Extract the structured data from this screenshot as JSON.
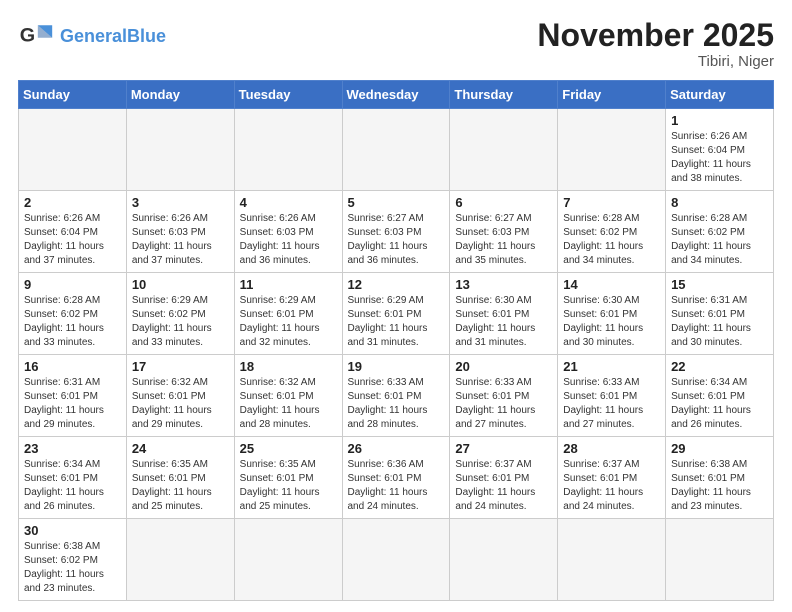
{
  "header": {
    "logo_general": "General",
    "logo_blue": "Blue",
    "month_title": "November 2025",
    "subtitle": "Tibiri, Niger"
  },
  "weekdays": [
    "Sunday",
    "Monday",
    "Tuesday",
    "Wednesday",
    "Thursday",
    "Friday",
    "Saturday"
  ],
  "days": [
    {
      "num": "",
      "info": ""
    },
    {
      "num": "",
      "info": ""
    },
    {
      "num": "",
      "info": ""
    },
    {
      "num": "",
      "info": ""
    },
    {
      "num": "",
      "info": ""
    },
    {
      "num": "",
      "info": ""
    },
    {
      "num": "1",
      "info": "Sunrise: 6:26 AM\nSunset: 6:04 PM\nDaylight: 11 hours\nand 38 minutes."
    },
    {
      "num": "2",
      "info": "Sunrise: 6:26 AM\nSunset: 6:04 PM\nDaylight: 11 hours\nand 37 minutes."
    },
    {
      "num": "3",
      "info": "Sunrise: 6:26 AM\nSunset: 6:03 PM\nDaylight: 11 hours\nand 37 minutes."
    },
    {
      "num": "4",
      "info": "Sunrise: 6:26 AM\nSunset: 6:03 PM\nDaylight: 11 hours\nand 36 minutes."
    },
    {
      "num": "5",
      "info": "Sunrise: 6:27 AM\nSunset: 6:03 PM\nDaylight: 11 hours\nand 36 minutes."
    },
    {
      "num": "6",
      "info": "Sunrise: 6:27 AM\nSunset: 6:03 PM\nDaylight: 11 hours\nand 35 minutes."
    },
    {
      "num": "7",
      "info": "Sunrise: 6:28 AM\nSunset: 6:02 PM\nDaylight: 11 hours\nand 34 minutes."
    },
    {
      "num": "8",
      "info": "Sunrise: 6:28 AM\nSunset: 6:02 PM\nDaylight: 11 hours\nand 34 minutes."
    },
    {
      "num": "9",
      "info": "Sunrise: 6:28 AM\nSunset: 6:02 PM\nDaylight: 11 hours\nand 33 minutes."
    },
    {
      "num": "10",
      "info": "Sunrise: 6:29 AM\nSunset: 6:02 PM\nDaylight: 11 hours\nand 33 minutes."
    },
    {
      "num": "11",
      "info": "Sunrise: 6:29 AM\nSunset: 6:01 PM\nDaylight: 11 hours\nand 32 minutes."
    },
    {
      "num": "12",
      "info": "Sunrise: 6:29 AM\nSunset: 6:01 PM\nDaylight: 11 hours\nand 31 minutes."
    },
    {
      "num": "13",
      "info": "Sunrise: 6:30 AM\nSunset: 6:01 PM\nDaylight: 11 hours\nand 31 minutes."
    },
    {
      "num": "14",
      "info": "Sunrise: 6:30 AM\nSunset: 6:01 PM\nDaylight: 11 hours\nand 30 minutes."
    },
    {
      "num": "15",
      "info": "Sunrise: 6:31 AM\nSunset: 6:01 PM\nDaylight: 11 hours\nand 30 minutes."
    },
    {
      "num": "16",
      "info": "Sunrise: 6:31 AM\nSunset: 6:01 PM\nDaylight: 11 hours\nand 29 minutes."
    },
    {
      "num": "17",
      "info": "Sunrise: 6:32 AM\nSunset: 6:01 PM\nDaylight: 11 hours\nand 29 minutes."
    },
    {
      "num": "18",
      "info": "Sunrise: 6:32 AM\nSunset: 6:01 PM\nDaylight: 11 hours\nand 28 minutes."
    },
    {
      "num": "19",
      "info": "Sunrise: 6:33 AM\nSunset: 6:01 PM\nDaylight: 11 hours\nand 28 minutes."
    },
    {
      "num": "20",
      "info": "Sunrise: 6:33 AM\nSunset: 6:01 PM\nDaylight: 11 hours\nand 27 minutes."
    },
    {
      "num": "21",
      "info": "Sunrise: 6:33 AM\nSunset: 6:01 PM\nDaylight: 11 hours\nand 27 minutes."
    },
    {
      "num": "22",
      "info": "Sunrise: 6:34 AM\nSunset: 6:01 PM\nDaylight: 11 hours\nand 26 minutes."
    },
    {
      "num": "23",
      "info": "Sunrise: 6:34 AM\nSunset: 6:01 PM\nDaylight: 11 hours\nand 26 minutes."
    },
    {
      "num": "24",
      "info": "Sunrise: 6:35 AM\nSunset: 6:01 PM\nDaylight: 11 hours\nand 25 minutes."
    },
    {
      "num": "25",
      "info": "Sunrise: 6:35 AM\nSunset: 6:01 PM\nDaylight: 11 hours\nand 25 minutes."
    },
    {
      "num": "26",
      "info": "Sunrise: 6:36 AM\nSunset: 6:01 PM\nDaylight: 11 hours\nand 24 minutes."
    },
    {
      "num": "27",
      "info": "Sunrise: 6:37 AM\nSunset: 6:01 PM\nDaylight: 11 hours\nand 24 minutes."
    },
    {
      "num": "28",
      "info": "Sunrise: 6:37 AM\nSunset: 6:01 PM\nDaylight: 11 hours\nand 24 minutes."
    },
    {
      "num": "29",
      "info": "Sunrise: 6:38 AM\nSunset: 6:01 PM\nDaylight: 11 hours\nand 23 minutes."
    },
    {
      "num": "30",
      "info": "Sunrise: 6:38 AM\nSunset: 6:02 PM\nDaylight: 11 hours\nand 23 minutes."
    },
    {
      "num": "",
      "info": ""
    },
    {
      "num": "",
      "info": ""
    },
    {
      "num": "",
      "info": ""
    },
    {
      "num": "",
      "info": ""
    },
    {
      "num": "",
      "info": ""
    },
    {
      "num": "",
      "info": ""
    }
  ]
}
